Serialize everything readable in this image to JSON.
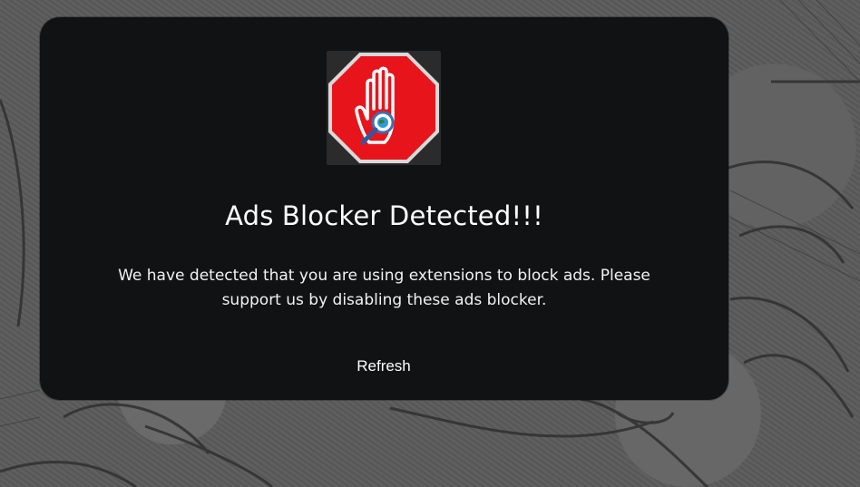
{
  "modal": {
    "title": "Ads Blocker Detected!!!",
    "message": "We have detected that you are using extensions to block ads. Please support us by disabling these ads blocker.",
    "refresh_label": "Refresh",
    "icon": "stop-hand-icon"
  },
  "colors": {
    "modal_bg": "#101214",
    "text": "#ffffff",
    "stop_red": "#e8141b",
    "backdrop": "#5a5a5a"
  }
}
